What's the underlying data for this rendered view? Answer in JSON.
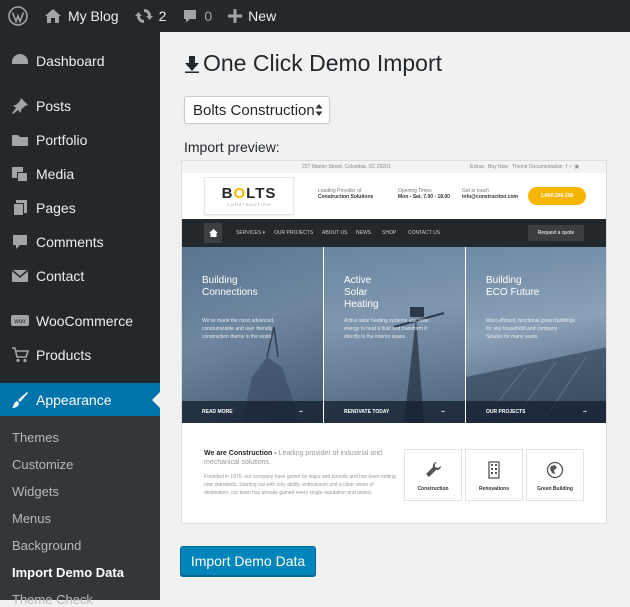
{
  "adminbar": {
    "site_name": "My Blog",
    "updates_count": "2",
    "comments_count": "0",
    "new_label": "New"
  },
  "sidebar": {
    "items": [
      {
        "label": "Dashboard",
        "icon": "dashboard-icon"
      },
      {
        "label": "Posts",
        "icon": "pin-icon"
      },
      {
        "label": "Portfolio",
        "icon": "folder-icon"
      },
      {
        "label": "Media",
        "icon": "media-icon"
      },
      {
        "label": "Pages",
        "icon": "pages-icon"
      },
      {
        "label": "Comments",
        "icon": "comment-icon"
      },
      {
        "label": "Contact",
        "icon": "envelope-icon"
      },
      {
        "label": "WooCommerce",
        "icon": "woocommerce-icon"
      },
      {
        "label": "Products",
        "icon": "cart-icon"
      },
      {
        "label": "Appearance",
        "icon": "brush-icon",
        "active": true
      }
    ],
    "submenu": [
      "Themes",
      "Customize",
      "Widgets",
      "Menus",
      "Background",
      "Import Demo Data",
      "Theme Check"
    ],
    "submenu_current": "Import Demo Data"
  },
  "main": {
    "title": "One Click Demo Import",
    "select_value": "Bolts Construction",
    "preview_label": "Import preview:",
    "import_button": "Import Demo Data"
  },
  "preview": {
    "topbar_address": "227 Marion Street, Columbia, SC 29201",
    "topbar_links": [
      "Extras",
      "Buy Now",
      "Theme Documentation"
    ],
    "logo_word_1": "B",
    "logo_word_o": "O",
    "logo_word_2": "LTS",
    "logo_tag": "CONSTRUCTION",
    "info": [
      {
        "line1": "Leading Provider of",
        "line2": "Construction Solutions"
      },
      {
        "line1": "Opening Times",
        "line2": "Mon - Sat, 7.00 - 18.00"
      },
      {
        "line1": "Get in touch",
        "line2": "info@construction.com"
      }
    ],
    "phone": "1-800-266-256",
    "nav": [
      "SERVICES ▾",
      "OUR PROJECTS",
      "ABOUT US",
      "NEWS",
      "SHOP",
      "CONTACT US"
    ],
    "quote_button": "Request a quote",
    "columns": [
      {
        "title_1": "Building",
        "title_2": "Connections",
        "title_3": "",
        "text": "We've made the most advanced, constumizable and user friendly construction theme in the world.",
        "footer": "READ MORE"
      },
      {
        "title_1": "Active",
        "title_2": "Solar",
        "title_3": "Heating",
        "text": "Active solar heating systems use solar energy to heat a fluid and transform it directly to the interior space.",
        "footer": "RENOVATE TODAY"
      },
      {
        "title_1": "Building",
        "title_2": "ECO Future",
        "title_3": "",
        "text": "Most efficient, functional green buildings for any household and company. Spaces for many years.",
        "footer": "OUR PROJECTS"
      }
    ],
    "about_title": "We are Construction -",
    "about_title_rest": "Leading provider of industrial and mechanical solutions.",
    "about_text": "Founded in 1970, our company have grown by leaps and bounds and has been setting new standards. Starting out with only ability, enthusiasm and a clear vision of destination, our team has already gained every single reputation and award.",
    "cards": [
      "Construction",
      "Renovations",
      "Green Building"
    ]
  },
  "colors": {
    "admin_dark": "#23282d",
    "accent_blue": "#0073aa",
    "button_blue": "#0085ba",
    "bolts_yellow": "#f5b500"
  }
}
